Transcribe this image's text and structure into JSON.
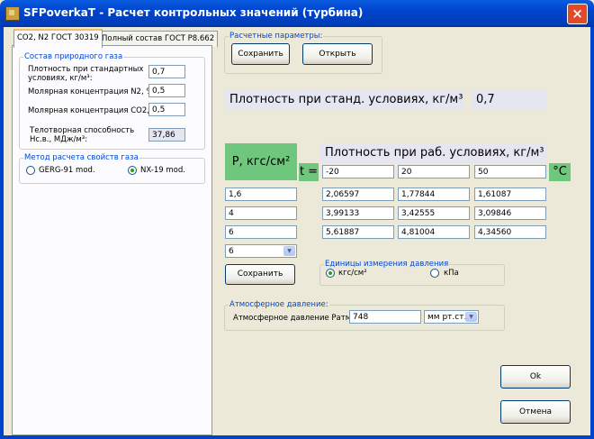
{
  "window": {
    "title": "SFPoverkaT - Расчет контрольных значений (турбина)",
    "close_label": "×"
  },
  "tabs": [
    {
      "label": "CO2, N2 ГОСТ 30319"
    },
    {
      "label": "Полный состав ГОСТ Р8.662"
    }
  ],
  "gas_composition": {
    "legend": "Состав природного газа",
    "density_label_1": "Плотность при стандартных",
    "density_label_2": "условиях, кг/м³:",
    "density_value": "0,7",
    "n2_label": "Молярная концентрация N2, %:",
    "n2_value": "0,5",
    "co2_label": "Молярная концентрация CO2, %:",
    "co2_value": "0,5",
    "heat_label_1": "Телотворная способность",
    "heat_label_2": "Нс.в., МДж/м³:",
    "heat_value": "37,86"
  },
  "method": {
    "legend": "Метод расчета свойств газа",
    "option1": "GERG-91 mod.",
    "option2": "NX-19 mod.",
    "selected": "NX-19 mod."
  },
  "calc_params": {
    "legend": "Расчетные параметры:",
    "save_label": "Сохранить",
    "open_label": "Открыть"
  },
  "std_density": {
    "label": "Плотность при станд. условиях, кг/м³",
    "value": "0,7"
  },
  "table": {
    "p_label": "P, кгс/см²",
    "t_label": "t =",
    "header": "Плотность при раб. условиях, кг/м³",
    "celsius": "°C",
    "temperatures": [
      "-20",
      "20",
      "50"
    ],
    "pressures": [
      "1,6",
      "4",
      "6"
    ],
    "rows": [
      [
        "2,06597",
        "1,77844",
        "1,61087"
      ],
      [
        "3,99133",
        "3,42555",
        "3,09846"
      ],
      [
        "5,61887",
        "4,81004",
        "4,34560"
      ]
    ],
    "count_value": "6",
    "save_label": "Сохранить"
  },
  "units": {
    "legend": "Единицы измерения давления",
    "option1": "кгс/см²",
    "option2": "кПа",
    "selected": "кгс/см²"
  },
  "atm": {
    "legend": "Атмосферное давление:",
    "label": "Атмосферное давление Ратм:",
    "value": "748",
    "unit": "мм рт.ст."
  },
  "buttons": {
    "ok_label": "Ok",
    "cancel_label": "Отмена"
  }
}
